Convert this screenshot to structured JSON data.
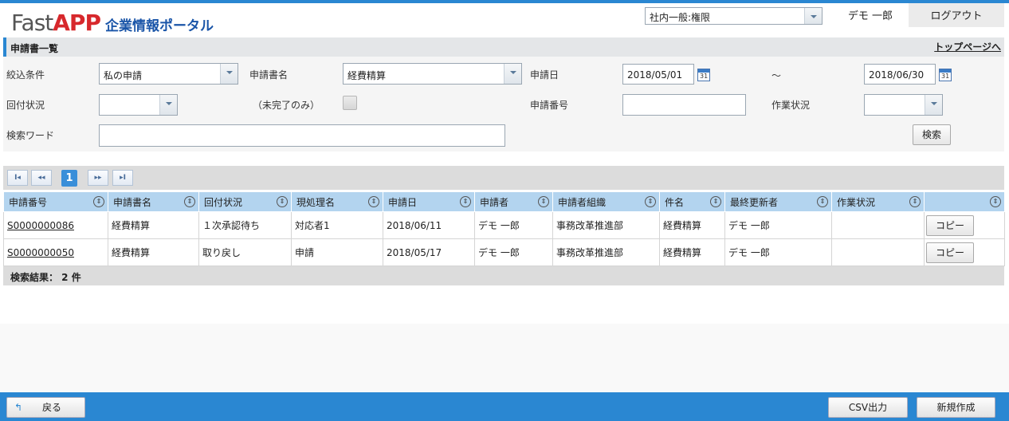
{
  "app": {
    "logo_fast": "Fast",
    "logo_app": "APP",
    "portal_name": "企業情報ポータル"
  },
  "header": {
    "role_select_value": "社内一般:権限",
    "user_name": "デモ 一郎",
    "logout_label": "ログアウト"
  },
  "section": {
    "title": "申請書一覧",
    "top_link": "トップページへ"
  },
  "filters": {
    "narrow_label": "絞込条件",
    "narrow_value": "私の申請",
    "form_name_label": "申請書名",
    "form_name_value": "経費精算",
    "apply_date_label": "申請日",
    "date_from": "2018/05/01",
    "date_sep": "～",
    "date_to": "2018/06/30",
    "calendar_day": "31",
    "circulation_label": "回付状況",
    "circulation_value": "",
    "incomplete_label": "（未完了のみ）",
    "app_number_label": "申請番号",
    "app_number_value": "",
    "work_status_label": "作業状況",
    "work_status_value": "",
    "keyword_label": "検索ワード",
    "keyword_value": "",
    "search_button": "検索"
  },
  "pager": {
    "first": "I◂",
    "prev": "◂◂",
    "current": "1",
    "next": "▸▸",
    "last": "▸I"
  },
  "table": {
    "sort_glyph": "⇕",
    "columns": [
      "申請番号",
      "申請書名",
      "回付状況",
      "現処理名",
      "申請日",
      "申請者",
      "申請者組織",
      "件名",
      "最終更新者",
      "作業状況",
      ""
    ],
    "rows": [
      {
        "app_no": "S0000000086",
        "form": "経費精算",
        "status": "１次承認待ち",
        "current": "対応者1",
        "date": "2018/06/11",
        "applicant": "デモ 一郎",
        "org": "事務改革推進部",
        "subject": "経費精算",
        "updater": "デモ 一郎",
        "work": "",
        "copy": "コピー"
      },
      {
        "app_no": "S0000000050",
        "form": "経費精算",
        "status": "取り戻し",
        "current": "申請",
        "date": "2018/05/17",
        "applicant": "デモ 一郎",
        "org": "事務改革推進部",
        "subject": "経費精算",
        "updater": "デモ 一郎",
        "work": "",
        "copy": "コピー"
      }
    ]
  },
  "result": {
    "label": "検索結果： 2 件"
  },
  "footer": {
    "back_label": "戻る",
    "back_icon": "↰",
    "csv_label": "CSV出力",
    "new_label": "新規作成"
  }
}
